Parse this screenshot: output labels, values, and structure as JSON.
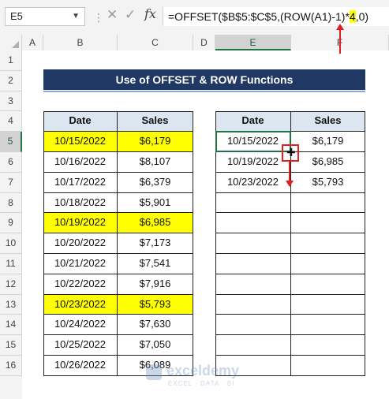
{
  "name_box": "E5",
  "formula_bar": {
    "fx_label": "fx",
    "formula_before": "=OFFSET($B$5:$C$5,(ROW(A1)-1)*",
    "formula_highlight": "4",
    "formula_after": ",0)"
  },
  "columns": [
    "A",
    "B",
    "C",
    "D",
    "E",
    "F"
  ],
  "rows": [
    "1",
    "2",
    "3",
    "4",
    "5",
    "6",
    "7",
    "8",
    "9",
    "10",
    "11",
    "12",
    "13",
    "14",
    "15",
    "16"
  ],
  "title": "Use of OFFSET & ROW Functions",
  "left_table": {
    "headers": [
      "Date",
      "Sales"
    ],
    "rows": [
      {
        "date": "10/15/2022",
        "sales": "$6,179",
        "highlight": true
      },
      {
        "date": "10/16/2022",
        "sales": "$8,107",
        "highlight": false
      },
      {
        "date": "10/17/2022",
        "sales": "$6,379",
        "highlight": false
      },
      {
        "date": "10/18/2022",
        "sales": "$5,901",
        "highlight": false
      },
      {
        "date": "10/19/2022",
        "sales": "$6,985",
        "highlight": true
      },
      {
        "date": "10/20/2022",
        "sales": "$7,173",
        "highlight": false
      },
      {
        "date": "10/21/2022",
        "sales": "$7,541",
        "highlight": false
      },
      {
        "date": "10/22/2022",
        "sales": "$7,916",
        "highlight": false
      },
      {
        "date": "10/23/2022",
        "sales": "$5,793",
        "highlight": true
      },
      {
        "date": "10/24/2022",
        "sales": "$7,630",
        "highlight": false
      },
      {
        "date": "10/25/2022",
        "sales": "$7,050",
        "highlight": false
      },
      {
        "date": "10/26/2022",
        "sales": "$6,089",
        "highlight": false
      }
    ]
  },
  "right_table": {
    "headers": [
      "Date",
      "Sales"
    ],
    "rows": [
      {
        "date": "10/15/2022",
        "sales": "$6,179"
      },
      {
        "date": "10/19/2022",
        "sales": "$6,985"
      },
      {
        "date": "10/23/2022",
        "sales": "$5,793"
      },
      {
        "date": "",
        "sales": ""
      },
      {
        "date": "",
        "sales": ""
      },
      {
        "date": "",
        "sales": ""
      },
      {
        "date": "",
        "sales": ""
      },
      {
        "date": "",
        "sales": ""
      },
      {
        "date": "",
        "sales": ""
      },
      {
        "date": "",
        "sales": ""
      },
      {
        "date": "",
        "sales": ""
      },
      {
        "date": "",
        "sales": ""
      }
    ]
  },
  "watermark": {
    "name": "exceldemy",
    "sub": "EXCEL · DATA · BI"
  },
  "colors": {
    "title_bg": "#1f3864",
    "highlight": "#ffff00",
    "header_bg": "#dce6f1",
    "annotation": "#e02020",
    "selection": "#217346"
  }
}
